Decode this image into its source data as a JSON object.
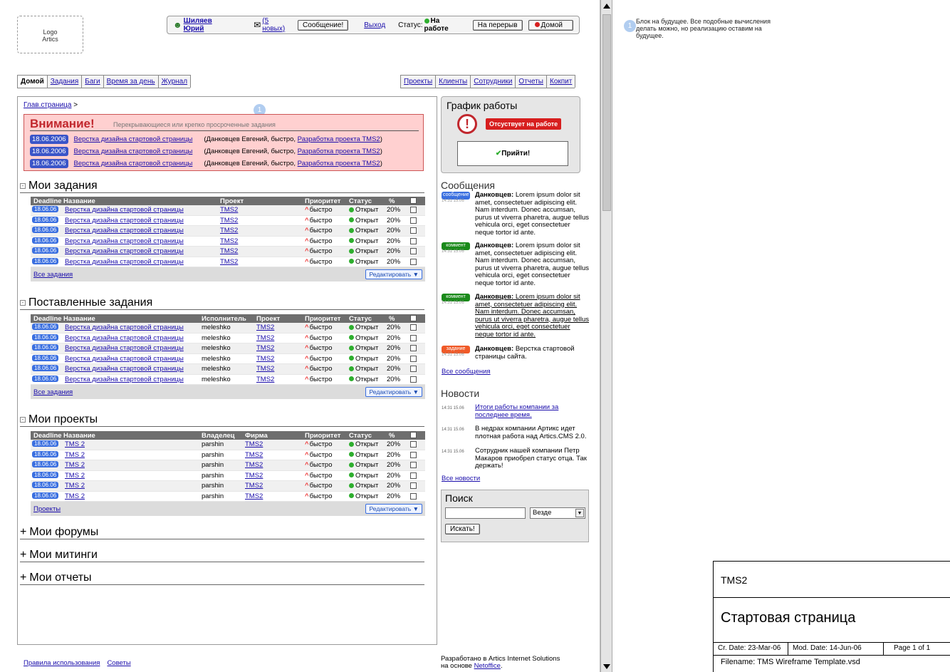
{
  "logo": {
    "line1": "Logo",
    "line2": "Artics"
  },
  "userbar": {
    "user_name": "Шиляев Юрий",
    "new_messages": "(5 новых)",
    "message_button": "Сообщение!",
    "logout": "Выход",
    "status_label": "Статус:",
    "status_value": "На работе",
    "break_button": "На перерыв",
    "home_button": "Домой"
  },
  "nav_left": [
    "Домой",
    "Задания",
    "Баги",
    "Время за день",
    "Журнал"
  ],
  "nav_right": [
    "Проекты",
    "Клиенты",
    "Сотрудники",
    "Отчеты",
    "Кокпит"
  ],
  "breadcrumb": {
    "link": "Глав.страница",
    "sep": ">"
  },
  "alert": {
    "title": "Внимание!",
    "subtitle": "Перекрывающиеся или крепко просроченные задания",
    "rows": [
      {
        "date": "18.06.2006",
        "task": "Верстка дизайна стартовой страницы",
        "who": "(Данковцев Евгений, быстро,",
        "project": "Разработка проекта TMS2",
        "close": ")"
      },
      {
        "date": "18.06.2006",
        "task": "Верстка дизайна стартовой страницы",
        "who": "(Данковцев Евгений, быстро,",
        "project": "Разработка проекта TMS2",
        "close": ")"
      },
      {
        "date": "18.06.2006",
        "task": "Верстка дизайна стартовой страницы",
        "who": "(Данковцев Евгений, быстро,",
        "project": "Разработка проекта TMS2",
        "close": ")"
      }
    ]
  },
  "my_tasks": {
    "title": "Мои задания",
    "headers": [
      "Deadline",
      "Название",
      "Проект",
      "Приоритет",
      "Статус",
      "%"
    ],
    "rows": [
      {
        "date": "18.06.06",
        "name": "Верстка дизайна стартовой страницы",
        "project": "TMS2",
        "priority": "быстро",
        "status": "Открыт",
        "pct": "20%"
      },
      {
        "date": "18.06.06",
        "name": "Верстка дизайна стартовой страницы",
        "project": "TMS2",
        "priority": "быстро",
        "status": "Открыт",
        "pct": "20%"
      },
      {
        "date": "18.06.06",
        "name": "Верстка дизайна стартовой страницы",
        "project": "TMS2",
        "priority": "быстро",
        "status": "Открыт",
        "pct": "20%"
      },
      {
        "date": "18.06.06",
        "name": "Верстка дизайна стартовой страницы",
        "project": "TMS2",
        "priority": "быстро",
        "status": "Открыт",
        "pct": "20%"
      },
      {
        "date": "18.06.06",
        "name": "Верстка дизайна стартовой страницы",
        "project": "TMS2",
        "priority": "быстро",
        "status": "Открыт",
        "pct": "20%"
      },
      {
        "date": "18.06.06",
        "name": "Верстка дизайна стартовой страницы",
        "project": "TMS2",
        "priority": "быстро",
        "status": "Открыт",
        "pct": "20%"
      }
    ],
    "footer_link": "Все задания",
    "edit": "Редактировать"
  },
  "assigned_tasks": {
    "title": "Поставленные задания",
    "headers": [
      "Deadline",
      "Название",
      "Исполнитель",
      "Проект",
      "Приоритет",
      "Статус",
      "%"
    ],
    "rows": [
      {
        "date": "18.06.06",
        "name": "Верстка дизайна стартовой страницы",
        "assignee": "meleshko",
        "project": "TMS2",
        "priority": "быстро",
        "status": "Открыт",
        "pct": "20%"
      },
      {
        "date": "18.06.06",
        "name": "Верстка дизайна стартовой страницы",
        "assignee": "meleshko",
        "project": "TMS2",
        "priority": "быстро",
        "status": "Открыт",
        "pct": "20%"
      },
      {
        "date": "18.06.06",
        "name": "Верстка дизайна стартовой страницы",
        "assignee": "meleshko",
        "project": "TMS2",
        "priority": "быстро",
        "status": "Открыт",
        "pct": "20%"
      },
      {
        "date": "18.06.06",
        "name": "Верстка дизайна стартовой страницы",
        "assignee": "meleshko",
        "project": "TMS2",
        "priority": "быстро",
        "status": "Открыт",
        "pct": "20%"
      },
      {
        "date": "18.06.06",
        "name": "Верстка дизайна стартовой страницы",
        "assignee": "meleshko",
        "project": "TMS2",
        "priority": "быстро",
        "status": "Открыт",
        "pct": "20%"
      },
      {
        "date": "18.06.06",
        "name": "Верстка дизайна стартовой страницы",
        "assignee": "meleshko",
        "project": "TMS2",
        "priority": "быстро",
        "status": "Открыт",
        "pct": "20%"
      }
    ],
    "footer_link": "Все задания",
    "edit": "Редактировать"
  },
  "my_projects": {
    "title": "Мои проекты",
    "headers": [
      "Deadline",
      "Название",
      "Владелец",
      "Фирма",
      "Приоритет",
      "Статус",
      "%"
    ],
    "rows": [
      {
        "date": "18.06.06",
        "name": "TMS 2",
        "owner": "parshin",
        "firm": "TMS2",
        "priority": "быстро",
        "status": "Открыт",
        "pct": "20%"
      },
      {
        "date": "18.06.06",
        "name": "TMS 2",
        "owner": "parshin",
        "firm": "TMS2",
        "priority": "быстро",
        "status": "Открыт",
        "pct": "20%"
      },
      {
        "date": "18.06.06",
        "name": "TMS 2",
        "owner": "parshin",
        "firm": "TMS2",
        "priority": "быстро",
        "status": "Открыт",
        "pct": "20%"
      },
      {
        "date": "18.06.06",
        "name": "TMS 2",
        "owner": "parshin",
        "firm": "TMS2",
        "priority": "быстро",
        "status": "Открыт",
        "pct": "20%"
      },
      {
        "date": "18.06.06",
        "name": "TMS 2",
        "owner": "parshin",
        "firm": "TMS2",
        "priority": "быстро",
        "status": "Открыт",
        "pct": "20%"
      },
      {
        "date": "18.06.06",
        "name": "TMS 2",
        "owner": "parshin",
        "firm": "TMS2",
        "priority": "быстро",
        "status": "Открыт",
        "pct": "20%"
      }
    ],
    "footer_link": "Проекты",
    "edit": "Редактировать"
  },
  "collapsed_sections": [
    "Мои форумы",
    "Мои митинги",
    "Мои отчеты"
  ],
  "schedule": {
    "title": "График работы",
    "absent": "Отсуствует на работе",
    "come": "Прийти!"
  },
  "messages": {
    "title": "Сообщения",
    "items": [
      {
        "type": "сообщение",
        "time": "14:31 15.06",
        "author": "Данковцев:",
        "text": "Lorem ipsum dolor sit amet, consectetuer adipiscing elit. Nam interdum. Donec accumsan, purus ut viverra pharetra, augue tellus vehicula orci, eget consectetuer neque tortor id ante."
      },
      {
        "type": "коммент",
        "time": "14:31 15.06",
        "author": "Данковцев:",
        "text": "Lorem ipsum dolor sit amet, consectetuer adipiscing elit. Nam interdum. Donec accumsan, purus ut viverra pharetra, augue tellus vehicula orci, eget consectetuer neque tortor id ante."
      },
      {
        "type": "коммент",
        "time": "14:31 15.06",
        "author": "Данковцев:",
        "text": "Lorem ipsum dolor sit amet, consectetuer adipiscing elit. Nam interdum. Donec accumsan, purus ut viverra pharetra, augue tellus vehicula orci, eget consectetuer neque tortor id ante."
      },
      {
        "type": "задание",
        "time": "14:31 15.06",
        "author": "Данковцев:",
        "text": "Верстка стартовой страницы сайта."
      }
    ],
    "all_link": "Все сообщения"
  },
  "news": {
    "title": "Новости",
    "items": [
      {
        "time": "14:31 15.06",
        "text": "Итоги работы компании за последнее время."
      },
      {
        "time": "14:31 15.06",
        "text": "В недрах компании Артикс идет плотная работа над Artics.CMS 2.0."
      },
      {
        "time": "14:31 15.06",
        "text": "Сотрудник нашей компании Петр Макаров приобрел статус отца. Так держать!"
      }
    ],
    "all_link": "Все новости"
  },
  "search": {
    "title": "Поиск",
    "input_value": "",
    "scope": "Везде",
    "button": "Искать!"
  },
  "footer": {
    "rules": "Правила использования",
    "tips": "Советы",
    "credit1": "Разработано в Artics Internet Solutions",
    "credit2_pre": "на основе",
    "credit2_link": "Netoffice",
    "credit2_post": "."
  },
  "callout_number": "1",
  "annotation": "Блок на будущее. Все подобные вычисления делать можно, но реализацию оставим на будущее.",
  "title_block": {
    "project": "TMS2",
    "page": "Стартовая страница",
    "created": "Cr. Date: 23-Mar-06",
    "modified": "Mod. Date: 14-Jun-06",
    "pages": "Page 1 of 1",
    "filename": "Filename: TMS Wireframe Template.vsd"
  },
  "colors": {
    "alert_bg": "#ffd0d0",
    "alert_title": "#c1272d",
    "badge_blue": "#3a55c8",
    "comment_green": "#1a8a1a",
    "task_red": "#f05a28",
    "status_green": "#2eae2e",
    "header_gray": "#6e6e6e"
  }
}
